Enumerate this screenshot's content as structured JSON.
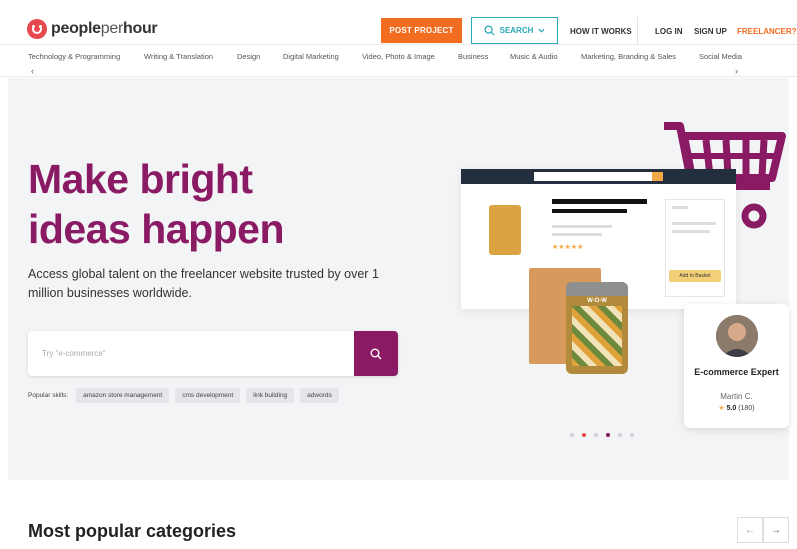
{
  "brand": {
    "name_bold": "people",
    "name_thin": "per",
    "name_bold2": "hour",
    "color": "#8a1a64",
    "logo_color": "#e5494f"
  },
  "header": {
    "post_project": "POST PROJECT",
    "search": "SEARCH",
    "how_it_works": "HOW IT WORKS",
    "log_in": "LOG IN",
    "sign_up": "SIGN UP",
    "freelancer": "FREELANCER?",
    "accent_orange": "#f36d21",
    "accent_teal": "#2aa8b8"
  },
  "categories": [
    "Technology & Programming",
    "Writing & Translation",
    "Design",
    "Digital Marketing",
    "Video, Photo & Image",
    "Business",
    "Music & Audio",
    "Marketing, Branding & Sales",
    "Social Media"
  ],
  "hero": {
    "title_line1": "Make bright",
    "title_line2": "ideas happen",
    "subtitle": "Access global talent on the freelancer website trusted by over 1 million businesses worldwide.",
    "search_placeholder": "Try \"e-commerce\"",
    "popular_label": "Popular skills:",
    "skills": [
      "amazon store management",
      "cms development",
      "link building",
      "adwords"
    ]
  },
  "illustration": {
    "product_label": "W-O-W",
    "add_to_basket": "Add to Basket"
  },
  "expert_card": {
    "role": "E-commerce Expert",
    "name": "Martin C.",
    "rating": "5.0",
    "reviews": "(180)"
  },
  "carousel": {
    "count": 6,
    "active_index": 3
  },
  "section": {
    "title": "Most popular categories"
  }
}
